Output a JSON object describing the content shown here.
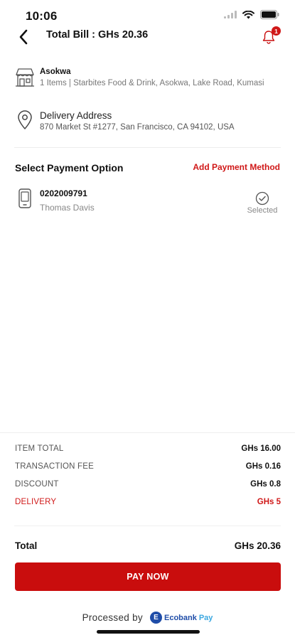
{
  "status_bar": {
    "time": "10:06"
  },
  "header": {
    "title": "Total Bill : GHs 20.36",
    "notification_count": "1"
  },
  "store": {
    "name": "Asokwa",
    "description": "1 Items | Starbites Food & Drink, Asokwa, Lake Road, Kumasi"
  },
  "delivery": {
    "title": "Delivery Address",
    "address": "870 Market St #1277, San Francisco, CA 94102, USA"
  },
  "payment": {
    "section_title": "Select Payment Option",
    "add_label": "Add Payment Method",
    "methods": [
      {
        "number": "0202009791",
        "name": "Thomas Davis",
        "status": "Selected"
      }
    ]
  },
  "summary": {
    "rows": [
      {
        "label": "ITEM TOTAL",
        "value": "GHs 16.00"
      },
      {
        "label": "TRANSACTION FEE",
        "value": "GHs 0.16"
      },
      {
        "label": "DISCOUNT",
        "value": "GHs 0.8"
      },
      {
        "label": "DELIVERY",
        "value": "GHs 5"
      }
    ],
    "total_label": "Total",
    "total_value": "GHs 20.36"
  },
  "pay_button": {
    "label": "PAY NOW"
  },
  "footer": {
    "processed_label": "Processed by",
    "brand_mark": "E",
    "brand_name": "Ecobank",
    "brand_suffix": "Pay"
  },
  "colors": {
    "accent": "#c90d0d",
    "brand_blue": "#1f4da8",
    "brand_light_blue": "#3aa7e0"
  }
}
